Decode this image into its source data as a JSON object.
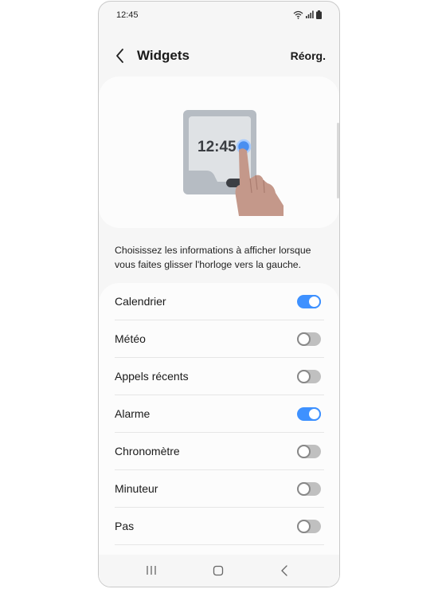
{
  "status_bar": {
    "time": "12:45",
    "icons": [
      "wifi-icon",
      "signal-icon",
      "battery-icon"
    ]
  },
  "header": {
    "back_icon": "chevron-left-icon",
    "title": "Widgets",
    "action_label": "Réorg."
  },
  "illustration": {
    "clock_text": "12:45",
    "icon": "hand-swipe-icon"
  },
  "description": "Choisissez les informations à afficher lorsque vous faites glisser l'horloge vers la gauche.",
  "widgets": [
    {
      "label": "Calendrier",
      "enabled": true
    },
    {
      "label": "Météo",
      "enabled": false
    },
    {
      "label": "Appels récents",
      "enabled": false
    },
    {
      "label": "Alarme",
      "enabled": true
    },
    {
      "label": "Chronomètre",
      "enabled": false
    },
    {
      "label": "Minuteur",
      "enabled": false
    },
    {
      "label": "Pas",
      "enabled": false
    }
  ],
  "navigation": {
    "recents_icon": "recent-apps-icon",
    "home_icon": "home-icon",
    "back_icon": "back-icon"
  },
  "colors": {
    "accent": "#3e91ff",
    "background": "#f6f6f6",
    "card": "#fcfcfc",
    "toggle_off": "#c0c0c0"
  }
}
